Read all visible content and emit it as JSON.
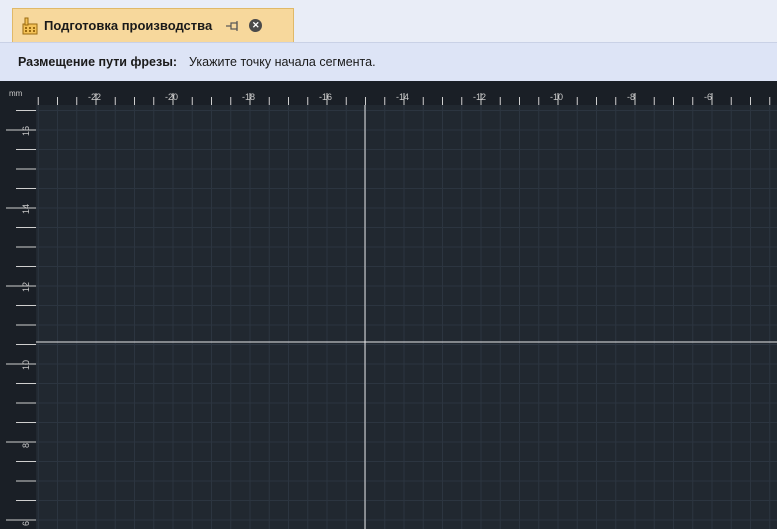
{
  "tab": {
    "title": "Подготовка производства",
    "pin_icon": "pin-icon",
    "close_icon": "close-icon",
    "app_icon": "factory-icon"
  },
  "prompt": {
    "label": "Размещение пути фрезы:",
    "text": "Укажите точку начала сегмента."
  },
  "ruler": {
    "unit": "mm",
    "x_labels": [
      "-22",
      "-20",
      "-18",
      "-16",
      "-14",
      "-12",
      "-10",
      "-8",
      "-6"
    ],
    "y_labels": [
      "16",
      "14",
      "12",
      "10",
      "8",
      "6"
    ]
  },
  "colors": {
    "canvas": "#212830",
    "ruler": "#1a1f26",
    "grid": "#2c3540",
    "crosshair": "#e8e8e8",
    "tab": "#f7d89c",
    "prompt_bar": "#dde4f6"
  }
}
